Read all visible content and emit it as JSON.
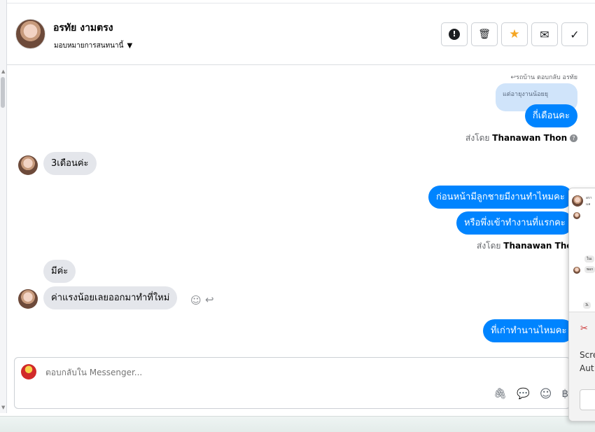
{
  "header": {
    "name": "อรทัย งามตรง",
    "assign_label": "มอบหมายการสนทนานี้"
  },
  "actions": [
    {
      "name": "spam-icon",
      "glyph": "!"
    },
    {
      "name": "trash-icon",
      "glyph": "🗑"
    },
    {
      "name": "star-icon",
      "glyph": "★"
    },
    {
      "name": "envelope-icon",
      "glyph": "✉"
    },
    {
      "name": "check-icon",
      "glyph": "✓"
    }
  ],
  "chat": {
    "reply_note": "รถบ้าน ตอบกลับ อรทัย",
    "quoted_text": "แต่อายุงานน้อยยุ",
    "messages": {
      "m1": "กี่เดือนคะ",
      "m2": "3เดือนค่ะ",
      "m3": "ก่อนหน้ามีลูกชายมีงานทำไหมคะ",
      "m4": "หรือพึ่งเข้าทำงานที่แรกคะ",
      "m5": "มีค่ะ",
      "m6": "ค่าแรงน้อยเลยออกมาทำที่ใหม่",
      "m7": "ที่เก่าทำนานไหมคะ"
    },
    "sent_by_prefix": "ส่งโดย",
    "sent_by_name": "Thanawan Thon",
    "help_glyph": "?"
  },
  "composer": {
    "placeholder": "ตอบกลับใน Messenger..."
  },
  "composer_tools": [
    {
      "name": "attachment-icon",
      "glyph": "🖇"
    },
    {
      "name": "saved-reply-icon",
      "glyph": "💬"
    },
    {
      "name": "emoji-icon",
      "glyph": "☺"
    },
    {
      "name": "payment-baht-icon",
      "glyph": "฿"
    }
  ],
  "overlay": {
    "tiny_name": "อรา",
    "tiny_line": "แล",
    "bubble_a": "ในเ",
    "bubble_b": "พอก",
    "bubble_c": "3เ",
    "text_1": "Scre",
    "text_2": "Aut"
  },
  "colors": {
    "accent": "#0084ff",
    "quoted_bg": "#d0e4fa",
    "incoming_bg": "#e4e6eb",
    "star": "#f5a623"
  }
}
